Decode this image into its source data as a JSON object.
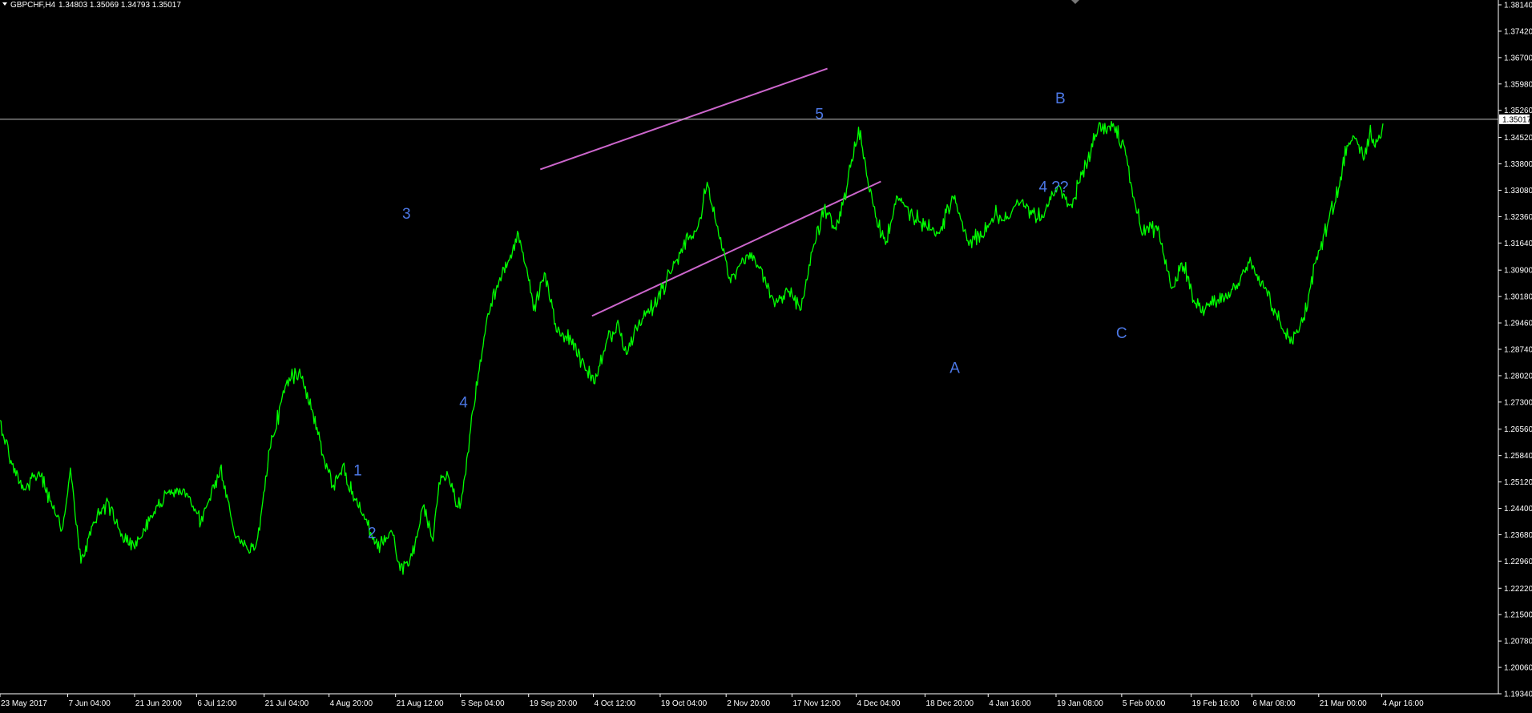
{
  "header": {
    "symbol": "GBPCHF,H4",
    "ohlc": "1.34803 1.35069 1.34793 1.35017"
  },
  "current_price_label": "1.35017",
  "colors": {
    "background": "#000000",
    "price_line": "#00ff00",
    "channel": "#cc66cc",
    "wave_label": "#4c78e6",
    "axis": "#ffffff",
    "bid_line": "#c0c0c0"
  },
  "chart_data": {
    "type": "line",
    "symbol": "GBPCHF",
    "timeframe": "H4",
    "ylim": [
      1.1934,
      1.3814
    ],
    "y_ticks": [
      "1.38140",
      "1.37420",
      "1.36700",
      "1.35980",
      "1.35260",
      "1.34520",
      "1.33800",
      "1.33080",
      "1.32360",
      "1.31640",
      "1.30900",
      "1.30180",
      "1.29460",
      "1.28740",
      "1.28020",
      "1.27300",
      "1.26560",
      "1.25840",
      "1.25120",
      "1.24400",
      "1.23680",
      "1.22960",
      "1.22220",
      "1.21500",
      "1.20780",
      "1.20060",
      "1.19340"
    ],
    "x_ticks": [
      "23 May 2017",
      "7 Jun 04:00",
      "21 Jun 20:00",
      "6 Jul 12:00",
      "21 Jul 04:00",
      "4 Aug 20:00",
      "21 Aug 12:00",
      "5 Sep 04:00",
      "19 Sep 20:00",
      "4 Oct 12:00",
      "19 Oct 04:00",
      "2 Nov 20:00",
      "17 Nov 12:00",
      "4 Dec 04:00",
      "18 Dec 20:00",
      "4 Jan 16:00",
      "19 Jan 08:00",
      "5 Feb 00:00",
      "19 Feb 16:00",
      "6 Mar 08:00",
      "21 Mar 00:00",
      "4 Apr 16:00"
    ],
    "x_tick_positions": [
      0,
      0.0452,
      0.0898,
      0.1312,
      0.1763,
      0.2196,
      0.264,
      0.3073,
      0.3528,
      0.396,
      0.4406,
      0.4846,
      0.5286,
      0.5714,
      0.6174,
      0.6595,
      0.7048,
      0.7486,
      0.795,
      0.8355,
      0.8801,
      0.9222
    ],
    "series": [
      {
        "x": [
          0.0,
          0.008,
          0.017,
          0.026,
          0.034,
          0.042,
          0.047,
          0.054,
          0.063,
          0.072,
          0.08,
          0.09,
          0.101,
          0.113,
          0.125,
          0.134,
          0.147,
          0.156,
          0.167,
          0.172,
          0.18,
          0.191,
          0.2,
          0.209,
          0.216,
          0.222,
          0.229,
          0.236,
          0.244,
          0.252,
          0.261,
          0.267,
          0.275,
          0.283,
          0.289,
          0.293,
          0.299,
          0.307,
          0.316,
          0.325,
          0.333,
          0.342,
          0.346,
          0.351,
          0.356,
          0.364,
          0.372,
          0.381,
          0.39,
          0.397,
          0.405,
          0.413,
          0.418,
          0.426,
          0.434,
          0.442,
          0.452,
          0.46,
          0.466,
          0.472,
          0.479,
          0.487,
          0.496,
          0.503,
          0.51,
          0.517,
          0.526,
          0.534,
          0.542,
          0.55,
          0.558,
          0.565,
          0.573,
          0.579,
          0.585,
          0.591,
          0.599,
          0.609,
          0.618,
          0.627,
          0.636,
          0.646,
          0.655,
          0.664,
          0.673,
          0.682,
          0.692,
          0.7,
          0.707,
          0.715,
          0.722,
          0.726,
          0.733,
          0.743,
          0.752,
          0.756,
          0.763,
          0.773,
          0.782,
          0.79,
          0.798,
          0.804,
          0.813,
          0.82,
          0.829,
          0.835,
          0.844,
          0.852,
          0.861,
          0.87,
          0.878,
          0.887,
          0.894,
          0.899,
          0.905,
          0.91,
          0.914,
          0.919,
          0.923
        ],
        "y": [
          1.268,
          1.256,
          1.249,
          1.254,
          1.246,
          1.239,
          1.255,
          1.229,
          1.24,
          1.246,
          1.238,
          1.233,
          1.242,
          1.249,
          1.248,
          1.24,
          1.255,
          1.238,
          1.232,
          1.236,
          1.26,
          1.278,
          1.282,
          1.27,
          1.258,
          1.25,
          1.256,
          1.246,
          1.241,
          1.233,
          1.238,
          1.227,
          1.231,
          1.245,
          1.235,
          1.251,
          1.253,
          1.244,
          1.271,
          1.296,
          1.306,
          1.314,
          1.319,
          1.31,
          1.298,
          1.308,
          1.292,
          1.29,
          1.283,
          1.278,
          1.29,
          1.294,
          1.286,
          1.294,
          1.298,
          1.304,
          1.312,
          1.318,
          1.321,
          1.333,
          1.321,
          1.307,
          1.312,
          1.313,
          1.307,
          1.299,
          1.303,
          1.298,
          1.314,
          1.326,
          1.32,
          1.331,
          1.348,
          1.334,
          1.323,
          1.316,
          1.329,
          1.324,
          1.321,
          1.319,
          1.329,
          1.317,
          1.318,
          1.324,
          1.323,
          1.328,
          1.323,
          1.327,
          1.332,
          1.327,
          1.335,
          1.339,
          1.348,
          1.349,
          1.34,
          1.329,
          1.319,
          1.321,
          1.304,
          1.31,
          1.3,
          1.298,
          1.301,
          1.303,
          1.308,
          1.311,
          1.304,
          1.297,
          1.289,
          1.296,
          1.311,
          1.323,
          1.332,
          1.343,
          1.345,
          1.339,
          1.346,
          1.344,
          1.349
        ]
      }
    ],
    "channel_lines": [
      {
        "x": [
          0.3606,
          0.5522
        ],
        "y": [
          1.3365,
          1.364
        ]
      },
      {
        "x": [
          0.3951,
          0.5879
        ],
        "y": [
          1.2965,
          1.3332
        ]
      }
    ],
    "annotations": [
      {
        "text": "1",
        "x": 0.2387,
        "y": 1.253
      },
      {
        "text": "2",
        "x": 0.2483,
        "y": 1.2359
      },
      {
        "text": "3",
        "x": 0.2713,
        "y": 1.323
      },
      {
        "text": "4",
        "x": 0.3094,
        "y": 1.2715
      },
      {
        "text": "5",
        "x": 0.5469,
        "y": 1.3502
      },
      {
        "text": "A",
        "x": 0.6372,
        "y": 1.281
      },
      {
        "text": "B",
        "x": 0.7077,
        "y": 1.3545
      },
      {
        "text": "4 ??",
        "x": 0.7032,
        "y": 1.3304
      },
      {
        "text": "C",
        "x": 0.7485,
        "y": 1.2905
      }
    ],
    "current_price": 1.35017
  }
}
